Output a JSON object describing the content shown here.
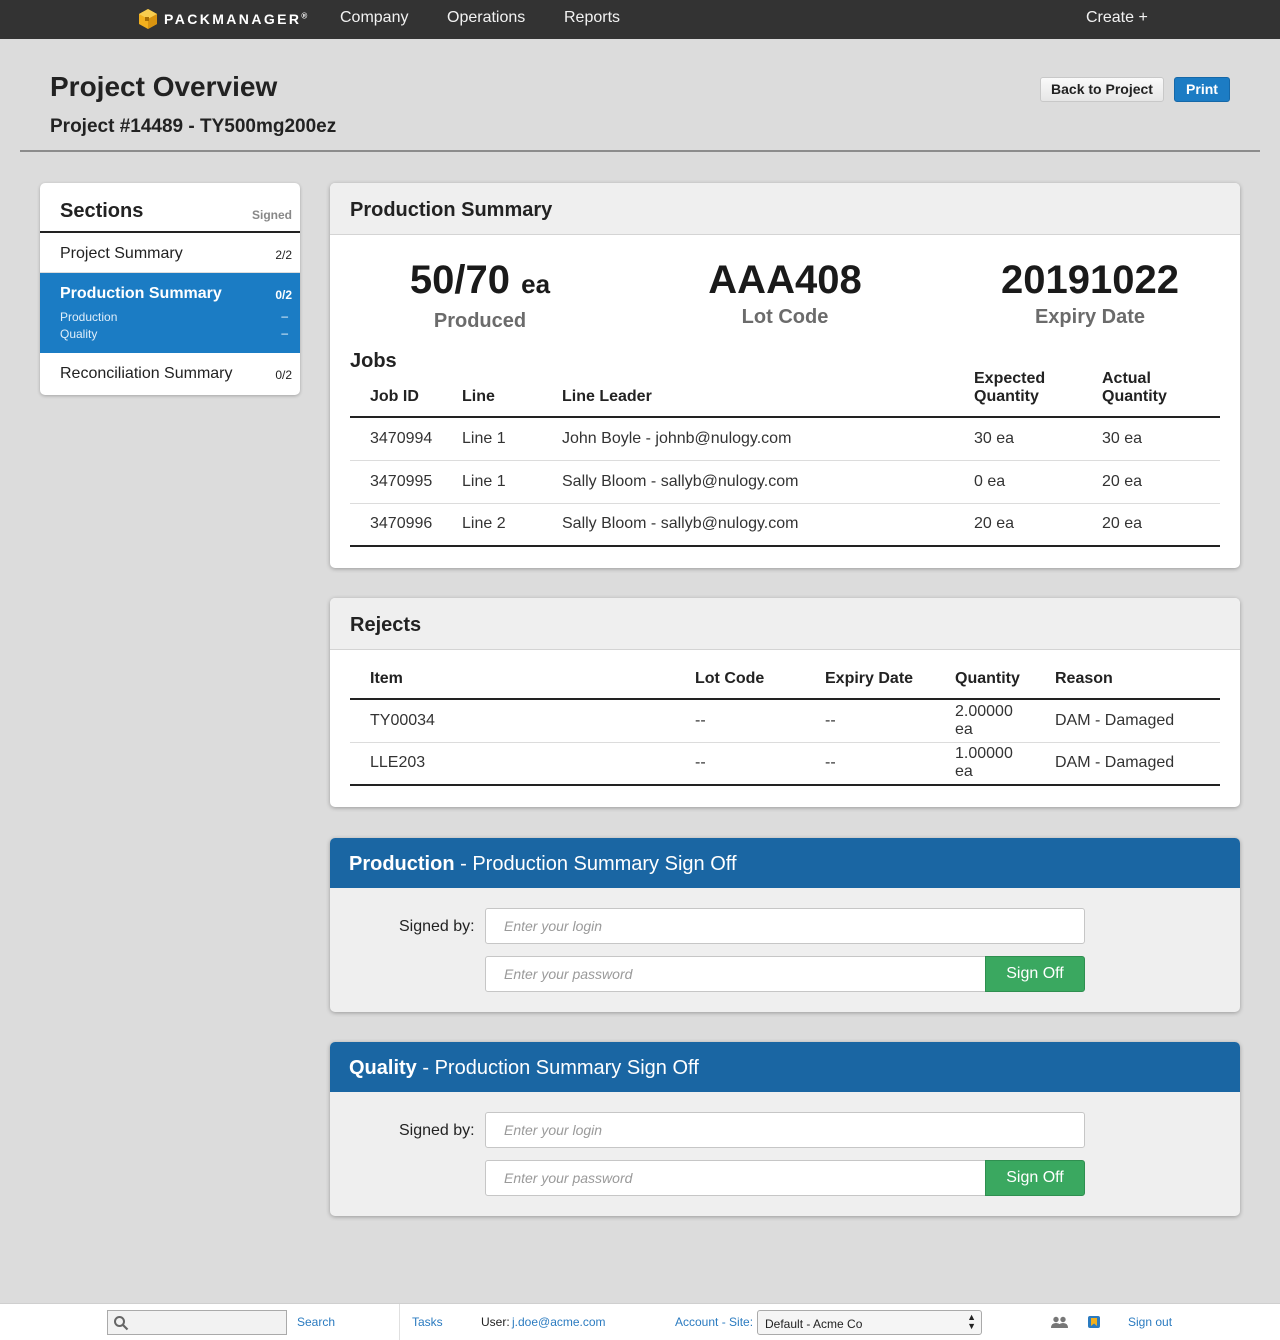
{
  "nav": {
    "brand": "PACKMANAGER",
    "brand_mark": "®",
    "links": [
      "Company",
      "Operations",
      "Reports"
    ],
    "create": "Create +"
  },
  "header": {
    "title": "Project Overview",
    "subtitle": "Project #14489 - TY500mg200ez",
    "back_button": "Back to Project",
    "print_button": "Print"
  },
  "sidebar": {
    "title": "Sections",
    "signed_header": "Signed",
    "items": [
      {
        "label": "Project Summary",
        "count": "2/2"
      },
      {
        "label": "Production Summary",
        "count": "0/2",
        "subitems": [
          {
            "label": "Production",
            "status": "–"
          },
          {
            "label": "Quality",
            "status": "–"
          }
        ]
      },
      {
        "label": "Reconciliation Summary",
        "count": "0/2"
      }
    ]
  },
  "production_summary": {
    "title": "Production Summary",
    "stats": [
      {
        "value": "50/70",
        "unit": "ea",
        "label": "Produced"
      },
      {
        "value": "AAA408",
        "unit": "",
        "label": "Lot Code"
      },
      {
        "value": "20191022",
        "unit": "",
        "label": "Expiry Date"
      }
    ],
    "jobs_title": "Jobs",
    "columns": [
      "Job ID",
      "Line",
      "Line Leader",
      "Expected Quantity",
      "Actual Quantity"
    ],
    "rows": [
      [
        "3470994",
        "Line 1",
        "John Boyle - johnb@nulogy.com",
        "30 ea",
        "30 ea"
      ],
      [
        "3470995",
        "Line 1",
        "Sally Bloom - sallyb@nulogy.com",
        "0 ea",
        "20 ea"
      ],
      [
        "3470996",
        "Line 2",
        "Sally Bloom - sallyb@nulogy.com",
        "20 ea",
        "20 ea"
      ]
    ]
  },
  "rejects": {
    "title": "Rejects",
    "columns": [
      "Item",
      "Lot Code",
      "Expiry Date",
      "Quantity",
      "Reason"
    ],
    "rows": [
      [
        "TY00034",
        "--",
        "--",
        "2.00000 ea",
        "DAM - Damaged"
      ],
      [
        "LLE203",
        "--",
        "--",
        "1.00000 ea",
        "DAM - Damaged"
      ]
    ]
  },
  "signoffs": [
    {
      "role": "Production",
      "title": " - Production Summary Sign Off",
      "signed_by": "Signed by:",
      "login_placeholder": "Enter your login",
      "password_placeholder": "Enter your password",
      "button": "Sign Off"
    },
    {
      "role": "Quality",
      "title": " - Production Summary Sign Off",
      "signed_by": "Signed by:",
      "login_placeholder": "Enter your login",
      "password_placeholder": "Enter your password",
      "button": "Sign Off"
    }
  ],
  "footer": {
    "search": "Search",
    "tasks": "Tasks",
    "user_label": "User:",
    "user_email": "j.doe@acme.com",
    "account": "Account",
    "account_sep": " - ",
    "site": "Site:",
    "site_value": "Default - Acme Co",
    "sign_out": "Sign out"
  },
  "colors": {
    "nav_bg": "#333333",
    "primary_blue": "#1b7cc4",
    "signoff_header": "#1a66a3",
    "signoff_button": "#3aa860",
    "link": "#2b7bc0"
  }
}
